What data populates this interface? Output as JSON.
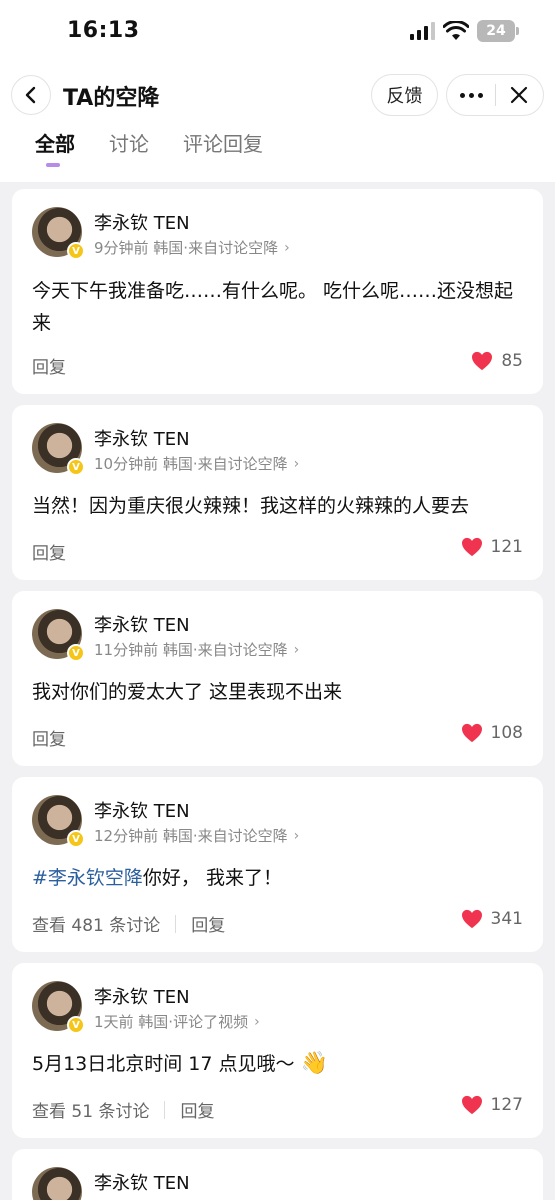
{
  "status": {
    "time": "16:13",
    "battery": "24"
  },
  "nav": {
    "title": "TA的空降",
    "feedback": "反馈"
  },
  "tabs": [
    {
      "label": "全部",
      "active": true
    },
    {
      "label": "讨论",
      "active": false
    },
    {
      "label": "评论回复",
      "active": false
    }
  ],
  "posts": [
    {
      "username": "李永钦 TEN",
      "meta": "9分钟前  韩国·来自讨论空降",
      "content": "今天下午我准备吃……有什么呢。 吃什么呢……还没想起来",
      "reply": "回复",
      "likes": "85"
    },
    {
      "username": "李永钦 TEN",
      "meta": "10分钟前  韩国·来自讨论空降",
      "content": "当然！因为重庆很火辣辣！我这样的火辣辣的人要去",
      "reply": "回复",
      "likes": "121"
    },
    {
      "username": "李永钦 TEN",
      "meta": "11分钟前  韩国·来自讨论空降",
      "content": "我对你们的爱太大了 这里表现不出来",
      "reply": "回复",
      "likes": "108"
    },
    {
      "username": "李永钦 TEN",
      "meta": "12分钟前  韩国·来自讨论空降",
      "topic": "#李永钦空降",
      "content": "你好， 我来了！",
      "view_discussions": "查看 481 条讨论",
      "reply": "回复",
      "likes": "341"
    },
    {
      "username": "李永钦 TEN",
      "meta": "1天前  韩国·评论了视频",
      "content": "5月13日北京时间 17 点见哦～",
      "emoji": "👋",
      "view_discussions": "查看 51 条讨论",
      "reply": "回复",
      "likes": "127"
    },
    {
      "username": "李永钦 TEN"
    }
  ],
  "colors": {
    "accent": "#b68bea",
    "heart": "#f0344f",
    "topic": "#2b5f9e"
  },
  "icons": {
    "back": "chevron-left-icon",
    "more": "more-dots-icon",
    "close": "close-icon",
    "heart": "heart-icon",
    "verified": "verified-badge-icon"
  }
}
